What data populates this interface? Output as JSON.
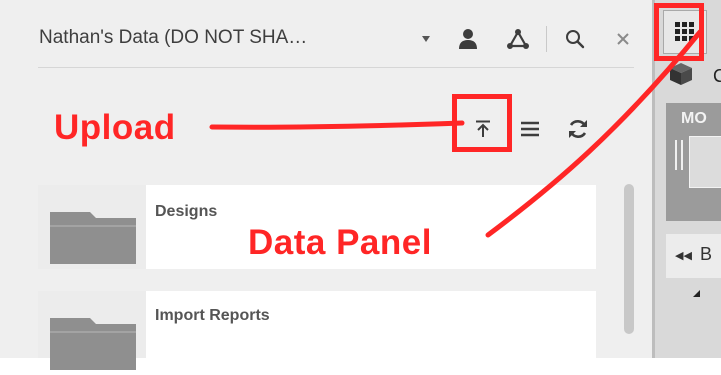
{
  "header": {
    "project_title": "Nathan's Data (DO NOT SHA…",
    "icons": [
      "dropdown-arrow-icon",
      "user-icon",
      "people-hub-icon",
      "search-icon",
      "close-icon"
    ]
  },
  "toolbar": {
    "icons": [
      "upload-icon",
      "list-view-icon",
      "refresh-icon"
    ]
  },
  "items": [
    {
      "name": "Designs",
      "icon": "folder-icon"
    },
    {
      "name": "Import Reports",
      "icon": "folder-icon"
    }
  ],
  "app_side": {
    "grid_icon": "data-panel-grid-icon",
    "title_fragment": "C",
    "mo_label": "MO",
    "b_label": "B"
  },
  "annotations": {
    "upload": "Upload",
    "data_panel": "Data Panel",
    "color": "#ff2626"
  }
}
